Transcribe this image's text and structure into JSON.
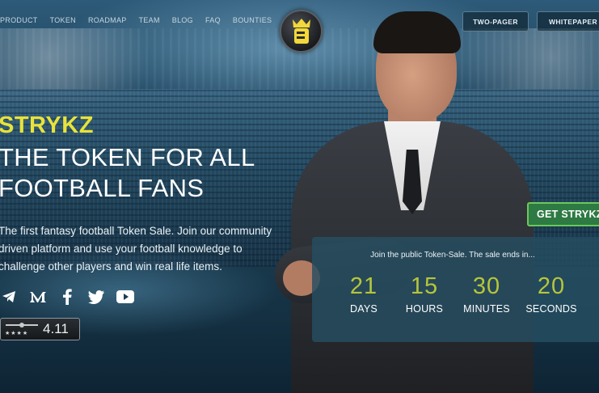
{
  "nav": {
    "items": [
      "PRODUCT",
      "TOKEN",
      "ROADMAP",
      "TEAM",
      "BLOG",
      "FAQ",
      "BOUNTIES"
    ]
  },
  "header": {
    "two_pager": "TWO-PAGER",
    "whitepaper": "WHITEPAPER"
  },
  "hero": {
    "brand": "STRYKZ",
    "headline": "THE TOKEN FOR ALL\nFOOTBALL FANS",
    "description": "The first fantasy football Token Sale. Join our community driven platform and use your football knowledge to challenge other players and win real life items."
  },
  "socials": [
    "telegram-icon",
    "medium-icon",
    "facebook-icon",
    "twitter-icon",
    "youtube-icon"
  ],
  "rating": {
    "score": "4.11"
  },
  "cta": {
    "label": "GET STRYKZ"
  },
  "countdown": {
    "title": "Join the public Token-Sale. The sale ends in...",
    "units": [
      {
        "value": "21",
        "label": "DAYS"
      },
      {
        "value": "15",
        "label": "HOURS"
      },
      {
        "value": "30",
        "label": "MINUTES"
      },
      {
        "value": "20",
        "label": "SECONDS"
      }
    ]
  },
  "colors": {
    "brand_yellow": "#e8e23a",
    "countdown_green": "#b5c63a",
    "cta_green": "#2d7a43"
  }
}
